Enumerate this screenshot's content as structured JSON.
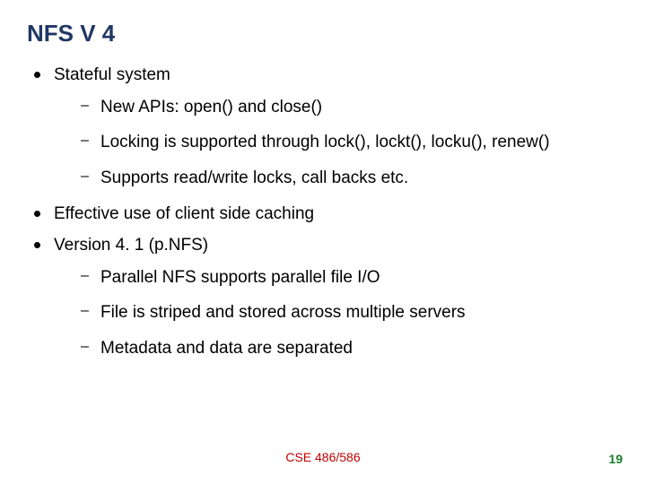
{
  "title": "NFS V 4",
  "bullets": {
    "b1": "Stateful system",
    "b1_sub": {
      "s1": "New APIs: open() and close()",
      "s2": "Locking is supported through lock(), lockt(), locku(), renew()",
      "s3": "Supports read/write locks, call backs etc."
    },
    "b2": "Effective use of client side caching",
    "b3": "Version 4. 1 (p.NFS)",
    "b3_sub": {
      "s1": "Parallel NFS supports parallel file I/O",
      "s2": "File is striped and stored across multiple servers",
      "s3": "Metadata and data are separated"
    }
  },
  "footer": "CSE 486/586",
  "page_number": "19"
}
